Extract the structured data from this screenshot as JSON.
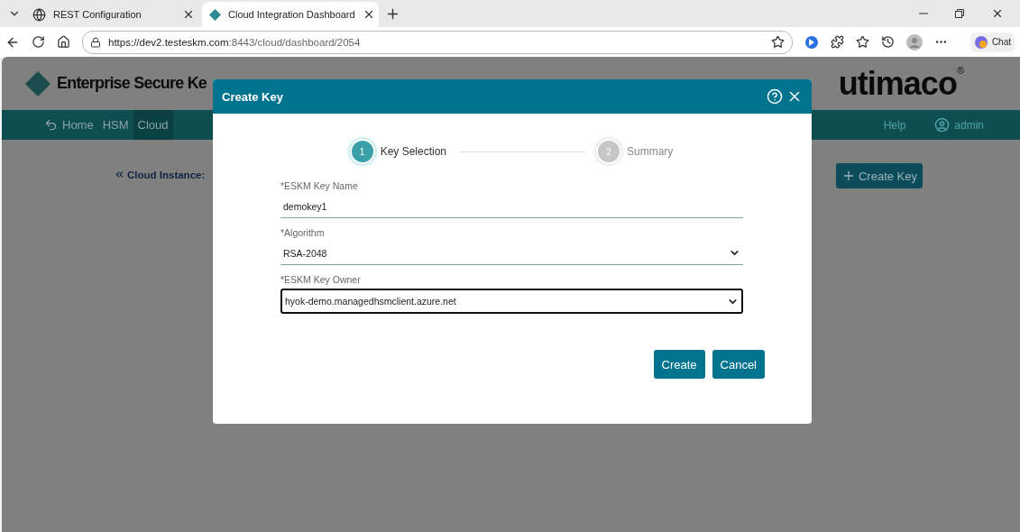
{
  "browser": {
    "tabs": [
      {
        "title": "REST Configuration",
        "selected": false
      },
      {
        "title": "Cloud Integration Dashboard",
        "selected": true
      }
    ],
    "url_host": "https://dev2.testeskm.com",
    "url_path": ":8443/cloud/dashboard/2054",
    "chat_label": "Chat"
  },
  "app": {
    "title": "Enterprise Secure Ke",
    "logo": "utimaco",
    "logo_mark": "®",
    "nav": [
      {
        "label": "Home",
        "selected": false
      },
      {
        "label": "HSM",
        "selected": false
      },
      {
        "label": "Cloud",
        "selected": true
      }
    ],
    "nav_right": [
      {
        "label": "Help"
      },
      {
        "label": "admin"
      }
    ],
    "breadcrumb": "Cloud Instance:",
    "create_button": "Create Key"
  },
  "dialog": {
    "title": "Create Key",
    "steps": [
      {
        "number": "1",
        "label": "Key Selection",
        "selected": true
      },
      {
        "number": "2",
        "label": "Summary",
        "selected": false
      }
    ],
    "fields": [
      {
        "kind": "text",
        "label": "*ESKM Key Name",
        "value": "demokey1",
        "focused": false
      },
      {
        "kind": "select",
        "label": "*Algorithm",
        "value": "RSA-2048",
        "focused": false
      },
      {
        "kind": "select",
        "label": "*ESKM Key Owner",
        "value": "hyok-demo.managedhsmclient.azure.net",
        "focused": true
      }
    ],
    "buttons": [
      "Create",
      "Cancel"
    ]
  }
}
